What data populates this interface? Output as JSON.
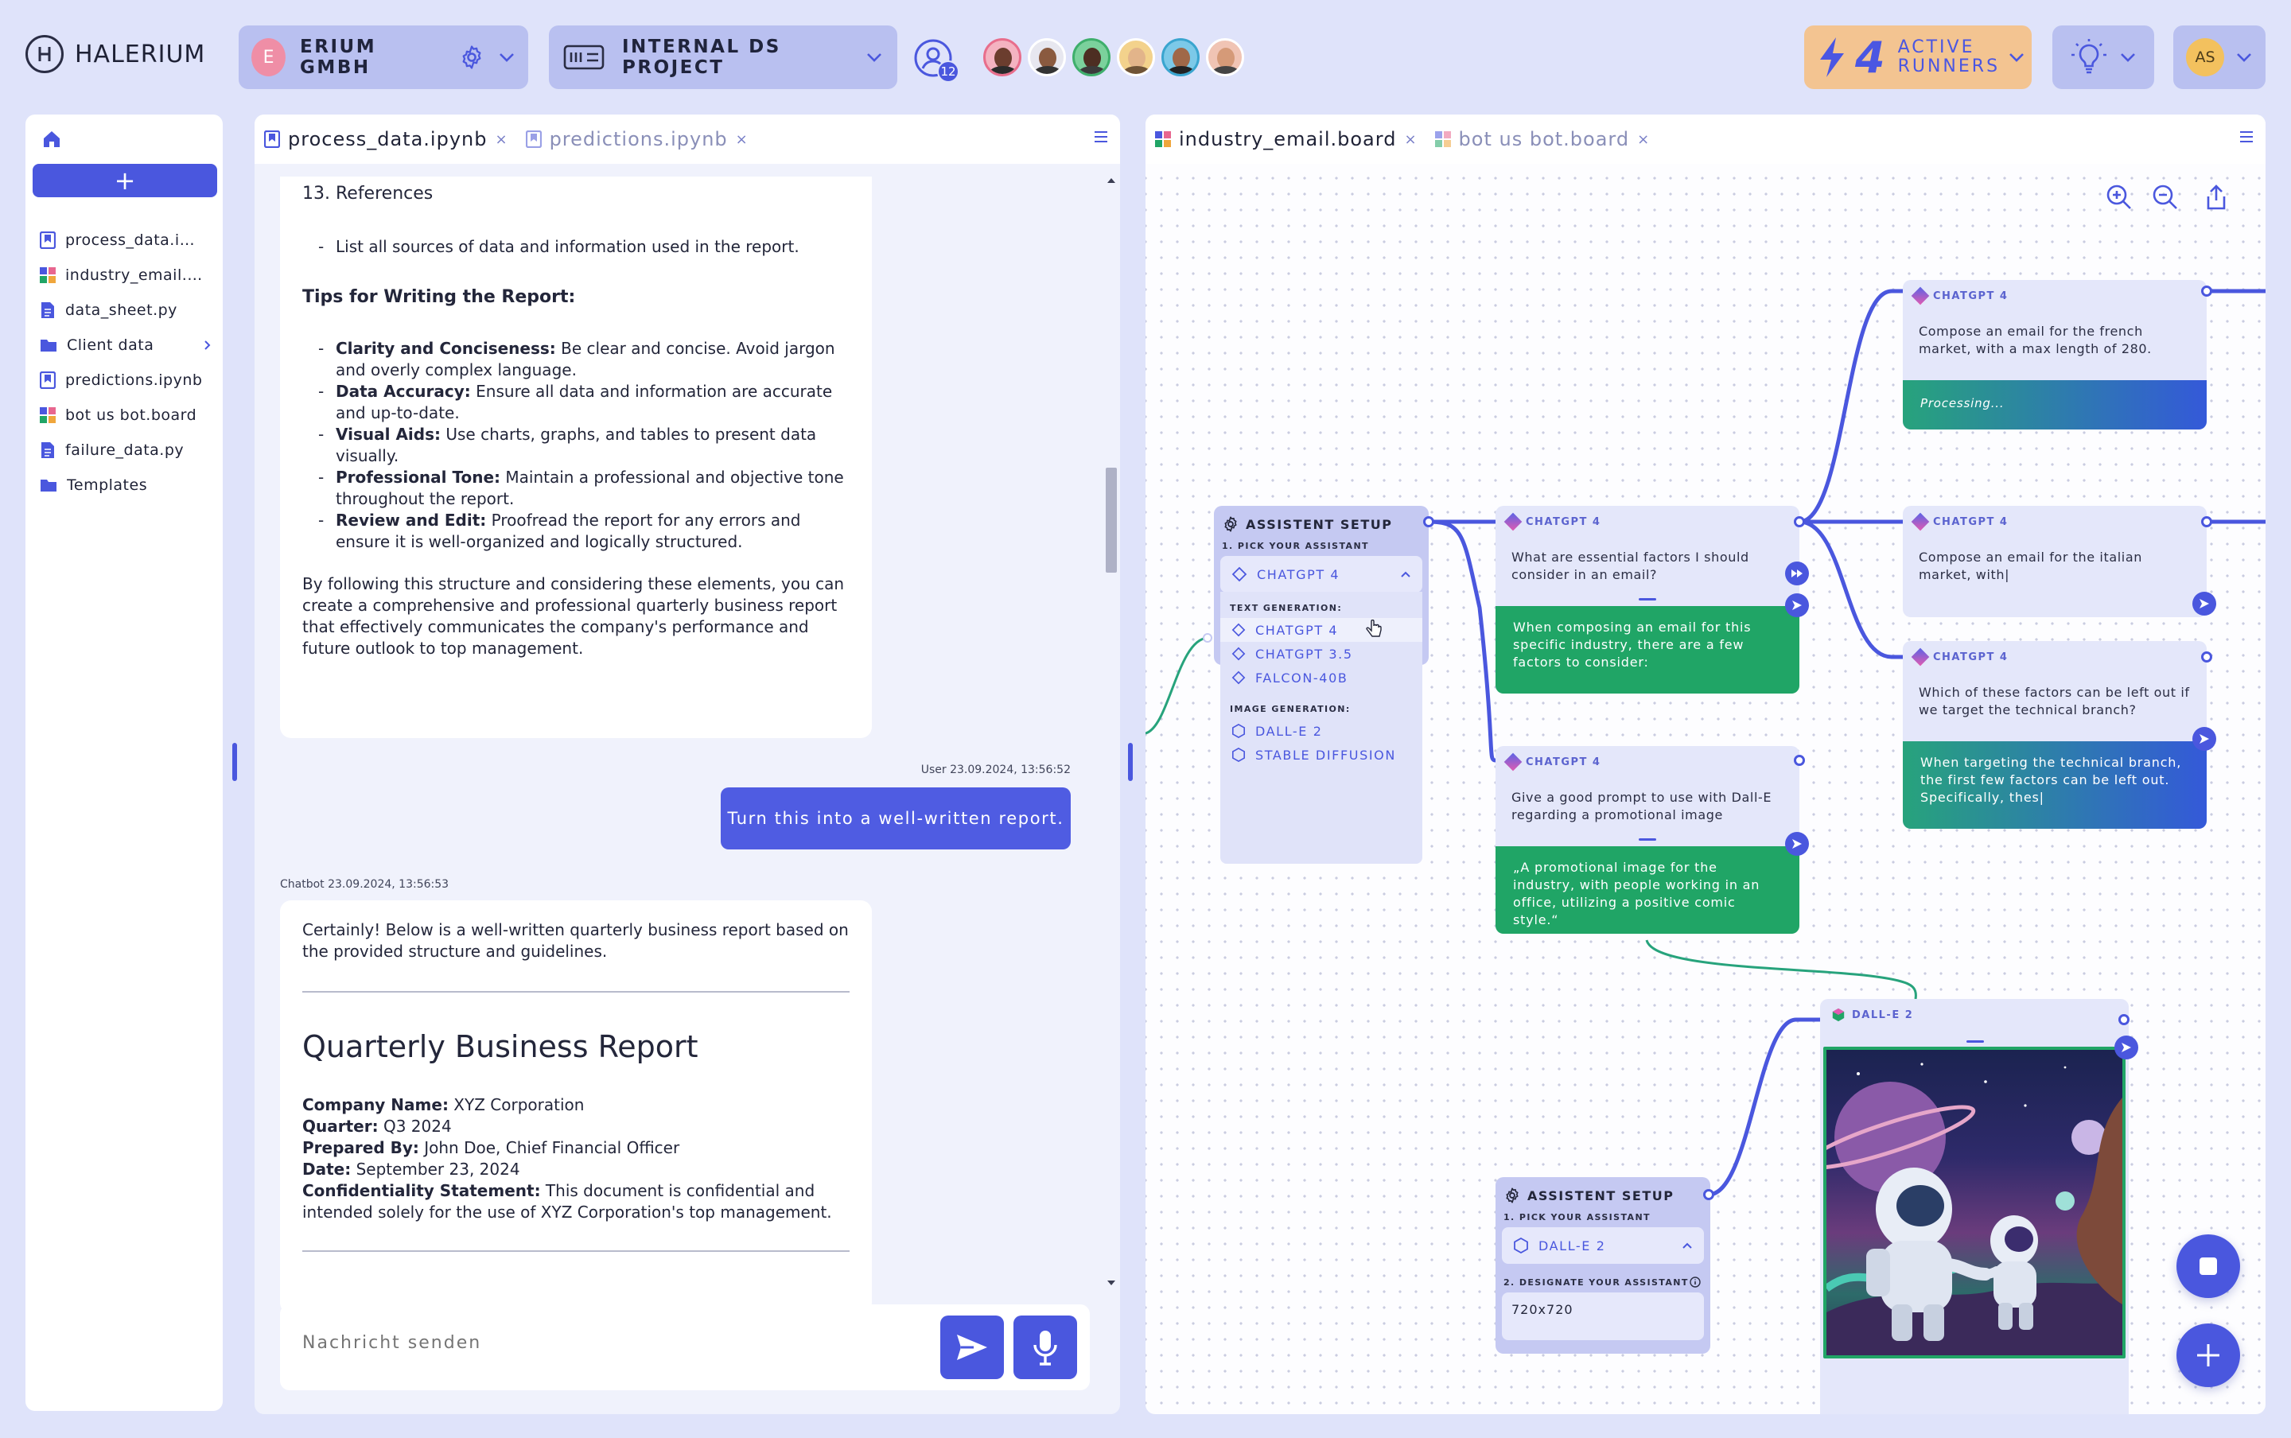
{
  "brand": {
    "name": "HALERIUM"
  },
  "org": {
    "initial": "E",
    "name": "ERIUM GMBH"
  },
  "project": {
    "name": "INTERNAL DS PROJECT"
  },
  "users": {
    "count": "12"
  },
  "runners": {
    "count": "4",
    "label_line1": "ACTIVE",
    "label_line2": "RUNNERS"
  },
  "me": {
    "initials": "AS"
  },
  "sidebar": {
    "items": [
      {
        "label": "process_data.ipynb",
        "icon": "notebook-icon"
      },
      {
        "label": "industry_email.board",
        "icon": "board-icon"
      },
      {
        "label": "data_sheet.py",
        "icon": "python-file-icon"
      },
      {
        "label": "Client data",
        "icon": "folder-icon"
      },
      {
        "label": "predictions.ipynb",
        "icon": "notebook-icon"
      },
      {
        "label": "bot us bot.board",
        "icon": "board-icon"
      },
      {
        "label": "failure_data.py",
        "icon": "python-file-icon"
      },
      {
        "label": "Templates",
        "icon": "folder-icon"
      }
    ]
  },
  "notebook": {
    "tabs": [
      {
        "label": "process_data.ipynb"
      },
      {
        "label": "predictions.ipynb"
      }
    ],
    "card1": {
      "refs_heading": "13. References",
      "refs_item": "List all sources of data and information used in the report.",
      "tips_heading": "Tips for Writing the Report:",
      "tips": [
        {
          "bold": "Clarity and Conciseness:",
          "text": " Be clear and concise. Avoid jargon and overly complex language."
        },
        {
          "bold": "Data Accuracy:",
          "text": " Ensure all data and information are accurate and up-to-date."
        },
        {
          "bold": "Visual Aids:",
          "text": " Use charts, graphs, and tables to present data visually."
        },
        {
          "bold": "Professional Tone:",
          "text": " Maintain a professional and objective tone throughout the report."
        },
        {
          "bold": "Review and Edit:",
          "text": " Proofread the report for any errors and ensure it is well-organized and logically structured."
        }
      ],
      "closing": "By following this structure and considering these elements, you can create a comprehensive and professional quarterly business report that effectively communicates the company's performance and future outlook to top management."
    },
    "user_ts": "User 23.09.2024, 13:56:52",
    "user_msg": "Turn this into a well-written report.",
    "bot_ts": "Chatbot 23.09.2024, 13:56:53",
    "card2": {
      "intro": "Certainly! Below is a well-written quarterly business report based on the provided structure and guidelines.",
      "title": "Quarterly Business Report",
      "fields": [
        {
          "bold": "Company Name:",
          "text": " XYZ Corporation"
        },
        {
          "bold": "Quarter:",
          "text": " Q3 2024"
        },
        {
          "bold": "Prepared By:",
          "text": " John Doe, Chief Financial Officer"
        },
        {
          "bold": "Date:",
          "text": " September 23, 2024"
        },
        {
          "bold": "Confidentiality Statement:",
          "text": " This document is confidential and intended solely for the use of XYZ Corporation's top management."
        }
      ]
    },
    "composer": {
      "placeholder": "Nachricht senden"
    }
  },
  "board": {
    "tabs": [
      {
        "label": "industry_email.board"
      },
      {
        "label": "bot us bot.board"
      }
    ],
    "setup1": {
      "title": "ASSISTENT SETUP",
      "pick_label": "1. PICK YOUR ASSISTANT",
      "selected": "CHATGPT 4",
      "text_gen_label": "TEXT GENERATION:",
      "text_options": [
        "CHATGPT 4",
        "CHATGPT 3.5",
        "FALCON-40B"
      ],
      "image_gen_label": "IMAGE GENERATION:",
      "image_options": [
        "DALL-E 2",
        "STABLE DIFFUSION"
      ]
    },
    "setup2": {
      "title": "ASSISTENT SETUP",
      "pick_label": "1. PICK YOUR ASSISTANT",
      "selected": "DALL-E 2",
      "designate_label": "2. DESIGNATE YOUR ASSISTANT",
      "size_value": "720x720"
    },
    "nodes": {
      "n1": {
        "model": "CHATGPT 4",
        "prompt": "What are essential factors I should consider in an email?",
        "answer": "When composing an email for this specific industry, there are a few factors to consider:"
      },
      "n2": {
        "model": "CHATGPT 4",
        "prompt": "Give a good prompt to use with Dall-E regarding a promotional image",
        "answer": "„A promotional image for the industry, with people working in an office, utilizing a positive comic style.“"
      },
      "n3": {
        "model": "CHATGPT 4",
        "prompt": "Compose an email for the french market, with a max length of 280.",
        "answer": "Processing..."
      },
      "n4": {
        "model": "CHATGPT 4",
        "prompt": "Compose an email for the italian market, with|"
      },
      "n5": {
        "model": "CHATGPT 4",
        "prompt": "Which of these factors can be left out if we target the technical branch?",
        "answer": "When targeting the technical branch, the first few factors can be left out. Specifically, thes|"
      },
      "n6": {
        "model": "DALL-E 2"
      }
    }
  },
  "colors": {
    "accent": "#4a57de",
    "green": "#20a566",
    "runners_bg": "#f3c491",
    "panel_bg": "#dfe3fa"
  }
}
